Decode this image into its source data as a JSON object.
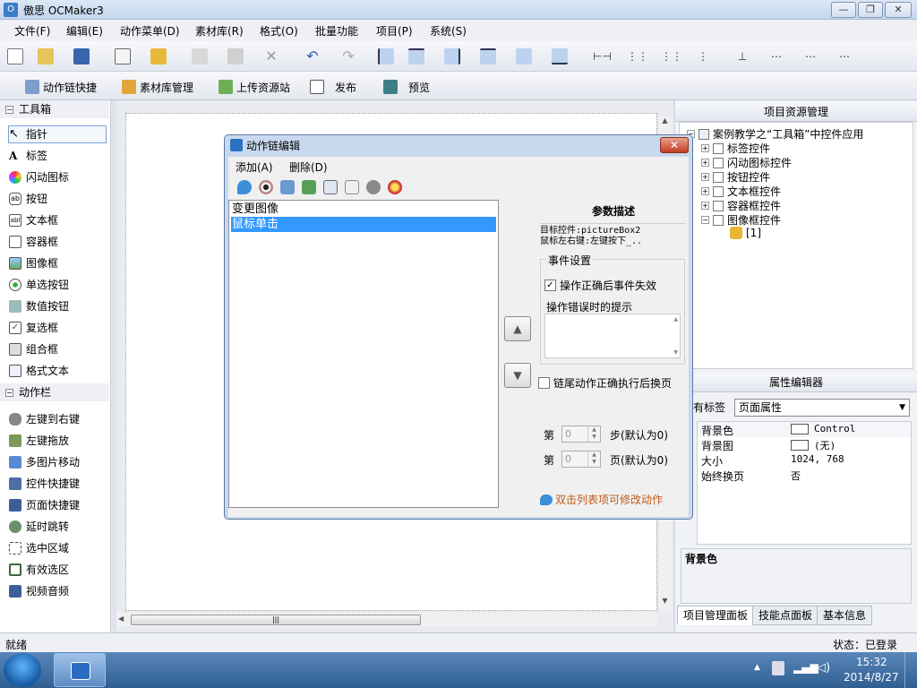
{
  "window": {
    "title": "傲思 OCMaker3",
    "app_icon": "app-logo-icon"
  },
  "menubar": [
    "文件(F)",
    "编辑(E)",
    "动作菜单(D)",
    "素材库(R)",
    "格式(O)",
    "批量功能",
    "项目(P)",
    "系统(S)"
  ],
  "toolbar2": [
    {
      "label": "动作链快捷",
      "icon": "action-chain-icon"
    },
    {
      "label": "素材库管理",
      "icon": "library-icon"
    },
    {
      "label": "上传资源站",
      "icon": "upload-icon"
    },
    {
      "label": "发布",
      "icon": "publish-icon"
    },
    {
      "label": "预览",
      "icon": "preview-icon"
    }
  ],
  "toolbox": {
    "section1": "工具箱",
    "tools": [
      "指针",
      "标签",
      "闪动图标",
      "按钮",
      "文本框",
      "容器框",
      "图像框",
      "单选按钮",
      "数值按钮",
      "复选框",
      "组合框",
      "格式文本"
    ],
    "section2": "动作栏",
    "actions": [
      "左键到右键",
      "左键拖放",
      "多图片移动",
      "控件快捷键",
      "页面快捷键",
      "延时跳转",
      "选中区域",
      "有效选区",
      "视频音频"
    ]
  },
  "project_panel": {
    "title": "项目资源管理",
    "root": "案例教学之“工具箱”中控件应用",
    "children": [
      "标签控件",
      "闪动图标控件",
      "按钮控件",
      "文本框控件",
      "容器框控件",
      "图像框控件"
    ],
    "leaf": "[1]"
  },
  "property_panel": {
    "title": "属性编辑器",
    "tag_label": "有标签",
    "tag_value": "页面属性",
    "rows": [
      {
        "key": "背景色",
        "value": "Control",
        "swatch": true
      },
      {
        "key": "背景图",
        "value": "(无)",
        "swatch": true
      },
      {
        "key": "大小",
        "value": "1024, 768",
        "swatch": false
      },
      {
        "key": "始终换页",
        "value": "否",
        "swatch": false
      }
    ],
    "desc_title": "背景色"
  },
  "bottom_tabs": [
    "项目管理面板",
    "技能点面板",
    "基本信息"
  ],
  "status": {
    "left": "就绪",
    "right": "状态：已登录"
  },
  "taskbar": {
    "time": "15:32",
    "date": "2014/8/27"
  },
  "dialog": {
    "title": "动作链编辑",
    "close": "✕",
    "menu": [
      "添加(A)",
      "删除(D)"
    ],
    "actions": [
      "变更图像",
      "鼠标单击"
    ],
    "selected_index": 1,
    "param_title": "参数描述",
    "param_line1": "目标控件:pictureBox2",
    "param_line2": "鼠标左右键:左键按下_..",
    "event_group": "事件设置",
    "event_checkbox": "操作正确后事件失效",
    "event_checked": true,
    "error_tip_label": "操作错误时的提示",
    "chain_checkbox": "链尾动作正确执行后换页",
    "chain_checked": false,
    "step_prefix": "第",
    "step_value": "0",
    "step_suffix": "步(默认为0)",
    "page_prefix": "第",
    "page_value": "0",
    "page_suffix": "页(默认为0)",
    "hint": "双击列表项可修改动作"
  }
}
